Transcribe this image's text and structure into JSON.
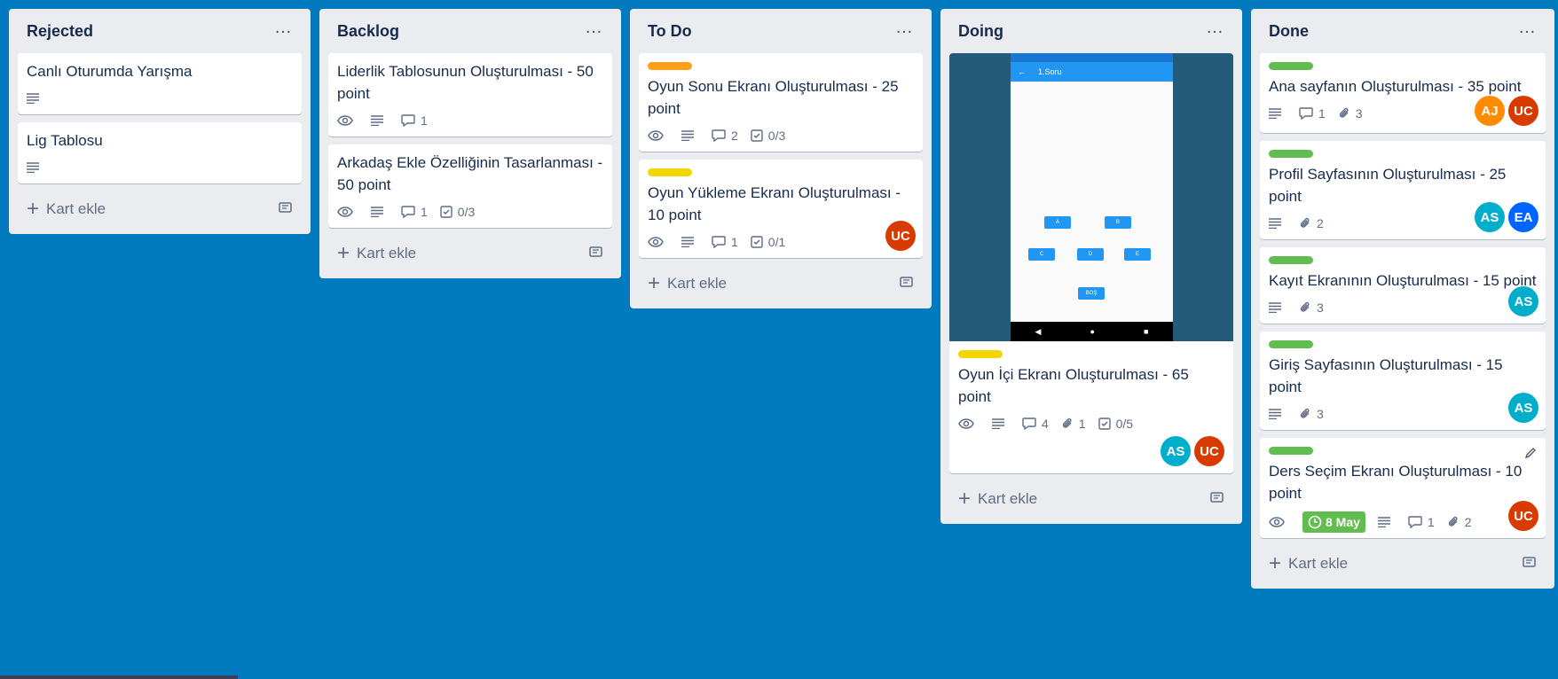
{
  "lists": [
    {
      "title": "Rejected",
      "add_label": "Kart ekle",
      "cards": [
        {
          "title": "Canlı Oturumda Yarışma"
        },
        {
          "title": "Lig Tablosu"
        }
      ]
    },
    {
      "title": "Backlog",
      "add_label": "Kart ekle",
      "cards": [
        {
          "title": "Liderlik Tablosunun Oluşturulması - 50 point",
          "comments": "1"
        },
        {
          "title": "Arkadaş Ekle Özelliğinin Tasarlanması - 50 point",
          "comments": "1",
          "checklist": "0/3"
        }
      ]
    },
    {
      "title": "To Do",
      "add_label": "Kart ekle",
      "cards": [
        {
          "title": "Oyun Sonu Ekranı Oluşturulması - 25 point",
          "label_color": "#ff9f1a",
          "comments": "2",
          "checklist": "0/3"
        },
        {
          "title": "Oyun Yükleme Ekranı Oluşturulması - 10 point",
          "label_color": "#f2d600",
          "comments": "1",
          "checklist": "0/1",
          "members": [
            "UC"
          ]
        }
      ]
    },
    {
      "title": "Doing",
      "add_label": "Kart ekle",
      "cards": [
        {
          "title": "Oyun İçi Ekranı Oluşturulması - 65 point",
          "label_color": "#f2d600",
          "comments": "4",
          "attachments": "1",
          "checklist": "0/5",
          "members": [
            "AS",
            "UC"
          ],
          "cover": {
            "screen_title": "1.Soru",
            "buttons": [
              "A",
              "B",
              "C",
              "D",
              "E",
              "BOŞ"
            ]
          }
        }
      ]
    },
    {
      "title": "Done",
      "add_label": "Kart ekle",
      "cards": [
        {
          "title": "Ana sayfanın Oluşturulması - 35 point",
          "label_color": "#61bd4f",
          "comments": "1",
          "attachments": "3",
          "members": [
            "AJ",
            "UC"
          ]
        },
        {
          "title": "Profil Sayfasının Oluşturulması - 25 point",
          "label_color": "#61bd4f",
          "attachments": "2",
          "members": [
            "AS",
            "EA"
          ]
        },
        {
          "title": "Kayıt Ekranının Oluşturulması - 15 point",
          "label_color": "#61bd4f",
          "attachments": "3",
          "members": [
            "AS"
          ]
        },
        {
          "title": "Giriş Sayfasının Oluşturulması - 15 point",
          "label_color": "#61bd4f",
          "attachments": "3",
          "members": [
            "AS"
          ]
        },
        {
          "title": "Ders Seçim Ekranı Oluşturulması - 10 point",
          "label_color": "#61bd4f",
          "due": "8 May",
          "comments": "1",
          "attachments": "2",
          "members": [
            "UC"
          ]
        }
      ]
    }
  ],
  "member_colors": {
    "AS": "#00aecc",
    "UC": "#d93a00",
    "AJ": "#ff8b00",
    "EA": "#0065ff"
  }
}
